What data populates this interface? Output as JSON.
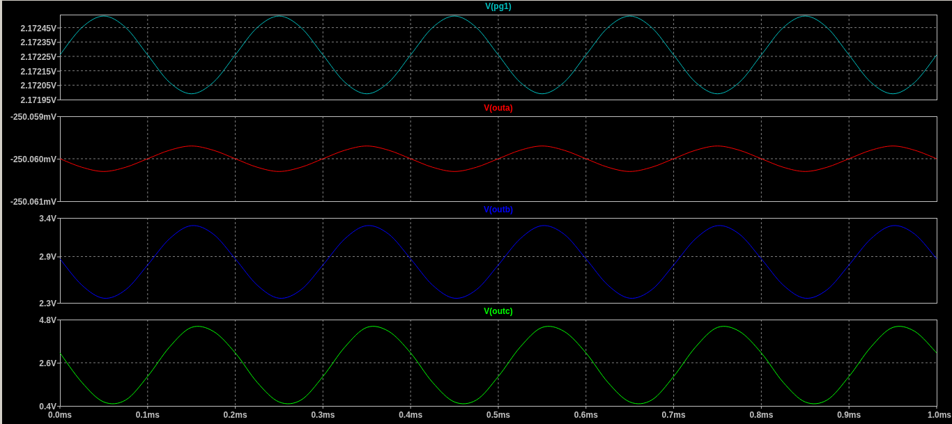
{
  "panes": [
    {
      "chart_data": {
        "type": "line",
        "grid": true,
        "x": [
          0,
          0.025,
          0.05,
          0.075,
          0.1,
          0.125,
          0.15,
          0.175,
          0.2,
          0.225,
          0.25,
          0.275,
          0.3,
          0.325,
          0.35,
          0.375,
          0.4,
          0.425,
          0.45,
          0.475,
          0.5,
          0.525,
          0.55,
          0.575,
          0.6,
          0.625,
          0.65,
          0.675,
          0.7,
          0.725,
          0.75,
          0.775,
          0.8,
          0.825,
          0.85,
          0.875,
          0.9,
          0.925,
          0.95,
          0.975,
          1
        ],
        "xlim": [
          0,
          1
        ],
        "ylim": [
          2.17195,
          2.17254
        ],
        "yticks": [
          {
            "value": 2.17195,
            "label": "2.17195V"
          },
          {
            "value": 2.17205,
            "label": "2.17205V"
          },
          {
            "value": 2.17215,
            "label": "2.17215V"
          },
          {
            "value": 2.17225,
            "label": "2.17225V"
          },
          {
            "value": 2.17235,
            "label": "2.17235V"
          },
          {
            "value": 2.17245,
            "label": "2.17245V"
          }
        ],
        "series": [
          {
            "name": "V(pg1)",
            "color": "#00c0c0",
            "values": [
              2.17226,
              2.17245,
              2.17253,
              2.17245,
              2.17226,
              2.17207,
              2.17199,
              2.17207,
              2.17226,
              2.17245,
              2.17253,
              2.17245,
              2.17226,
              2.17207,
              2.17199,
              2.17207,
              2.17226,
              2.17245,
              2.17253,
              2.17245,
              2.17226,
              2.17207,
              2.17199,
              2.17207,
              2.17226,
              2.17245,
              2.17253,
              2.17245,
              2.17226,
              2.17207,
              2.17199,
              2.17207,
              2.17226,
              2.17245,
              2.17253,
              2.17245,
              2.17226,
              2.17207,
              2.17199,
              2.17207,
              2.17226
            ]
          }
        ]
      }
    },
    {
      "chart_data": {
        "type": "line",
        "grid": true,
        "x": [
          0,
          0.025,
          0.05,
          0.075,
          0.1,
          0.125,
          0.15,
          0.175,
          0.2,
          0.225,
          0.25,
          0.275,
          0.3,
          0.325,
          0.35,
          0.375,
          0.4,
          0.425,
          0.45,
          0.475,
          0.5,
          0.525,
          0.55,
          0.575,
          0.6,
          0.625,
          0.65,
          0.675,
          0.7,
          0.725,
          0.75,
          0.775,
          0.8,
          0.825,
          0.85,
          0.875,
          0.9,
          0.925,
          0.95,
          0.975,
          1
        ],
        "xlim": [
          0,
          1
        ],
        "ylim": [
          -250.061,
          -250.059
        ],
        "yticks": [
          {
            "value": -250.061,
            "label": "-250.061mV"
          },
          {
            "value": -250.06,
            "label": "-250.060mV"
          },
          {
            "value": -250.059,
            "label": "-250.059mV"
          }
        ],
        "series": [
          {
            "name": "V(outa)",
            "color": "#ff0000",
            "values": [
              -250.06,
              -250.0602,
              -250.0603,
              -250.0602,
              -250.06,
              -250.0598,
              -250.0597,
              -250.0598,
              -250.06,
              -250.0602,
              -250.0603,
              -250.0602,
              -250.06,
              -250.0598,
              -250.0597,
              -250.0598,
              -250.06,
              -250.0602,
              -250.0603,
              -250.0602,
              -250.06,
              -250.0598,
              -250.0597,
              -250.0598,
              -250.06,
              -250.0602,
              -250.0603,
              -250.0602,
              -250.06,
              -250.0598,
              -250.0597,
              -250.0598,
              -250.06,
              -250.0602,
              -250.0603,
              -250.0602,
              -250.06,
              -250.0598,
              -250.0597,
              -250.0598,
              -250.06
            ]
          }
        ]
      }
    },
    {
      "chart_data": {
        "type": "line",
        "grid": true,
        "x": [
          0,
          0.025,
          0.05,
          0.075,
          0.1,
          0.125,
          0.15,
          0.175,
          0.2,
          0.225,
          0.25,
          0.275,
          0.3,
          0.325,
          0.35,
          0.375,
          0.4,
          0.425,
          0.45,
          0.475,
          0.5,
          0.525,
          0.55,
          0.575,
          0.6,
          0.625,
          0.65,
          0.675,
          0.7,
          0.725,
          0.75,
          0.775,
          0.8,
          0.825,
          0.85,
          0.875,
          0.9,
          0.925,
          0.95,
          0.975,
          1
        ],
        "xlim": [
          0,
          1
        ],
        "ylim": [
          2.3,
          3.4
        ],
        "yticks": [
          {
            "value": 2.3,
            "label": "2.3V"
          },
          {
            "value": 2.9,
            "label": "2.9V"
          },
          {
            "value": 3.4,
            "label": "3.4V"
          }
        ],
        "series": [
          {
            "name": "V(outb)",
            "color": "#0000ff",
            "values": [
              2.87,
              2.53,
              2.36,
              2.47,
              2.79,
              3.13,
              3.3,
              3.19,
              2.87,
              2.53,
              2.36,
              2.47,
              2.79,
              3.13,
              3.3,
              3.19,
              2.87,
              2.53,
              2.36,
              2.47,
              2.79,
              3.13,
              3.3,
              3.19,
              2.87,
              2.53,
              2.36,
              2.47,
              2.79,
              3.13,
              3.3,
              3.19,
              2.87,
              2.53,
              2.36,
              2.47,
              2.79,
              3.13,
              3.3,
              3.19,
              2.87
            ]
          }
        ]
      }
    },
    {
      "chart_data": {
        "type": "line",
        "grid": true,
        "x": [
          0,
          0.025,
          0.05,
          0.075,
          0.1,
          0.125,
          0.15,
          0.175,
          0.2,
          0.225,
          0.25,
          0.275,
          0.3,
          0.325,
          0.35,
          0.375,
          0.4,
          0.425,
          0.45,
          0.475,
          0.5,
          0.525,
          0.55,
          0.575,
          0.6,
          0.625,
          0.65,
          0.675,
          0.7,
          0.725,
          0.75,
          0.775,
          0.8,
          0.825,
          0.85,
          0.875,
          0.9,
          0.925,
          0.95,
          0.975,
          1
        ],
        "xlim": [
          0,
          1
        ],
        "ylim": [
          0.4,
          4.8
        ],
        "xticks": [
          {
            "value": 0,
            "label": "0.0ms"
          },
          {
            "value": 0.1,
            "label": "0.1ms"
          },
          {
            "value": 0.2,
            "label": "0.2ms"
          },
          {
            "value": 0.3,
            "label": "0.3ms"
          },
          {
            "value": 0.4,
            "label": "0.4ms"
          },
          {
            "value": 0.5,
            "label": "0.5ms"
          },
          {
            "value": 0.6,
            "label": "0.6ms"
          },
          {
            "value": 0.7,
            "label": "0.7ms"
          },
          {
            "value": 0.8,
            "label": "0.8ms"
          },
          {
            "value": 0.9,
            "label": "0.9ms"
          },
          {
            "value": 1,
            "label": "1.0ms"
          }
        ],
        "yticks": [
          {
            "value": 0.4,
            "label": "0.4V"
          },
          {
            "value": 2.6,
            "label": "2.6V"
          },
          {
            "value": 4.8,
            "label": "4.8V"
          }
        ],
        "series": [
          {
            "name": "V(outc)",
            "color": "#00ff00",
            "values": [
              3.1,
              1.6,
              0.6,
              0.7,
              1.9,
              3.4,
              4.4,
              4.2,
              3.1,
              1.6,
              0.6,
              0.7,
              1.9,
              3.4,
              4.4,
              4.2,
              3.1,
              1.6,
              0.6,
              0.7,
              1.9,
              3.4,
              4.4,
              4.2,
              3.1,
              1.6,
              0.6,
              0.7,
              1.9,
              3.4,
              4.4,
              4.2,
              3.1,
              1.6,
              0.6,
              0.7,
              1.9,
              3.4,
              4.4,
              4.2,
              3.1
            ]
          }
        ]
      }
    }
  ]
}
